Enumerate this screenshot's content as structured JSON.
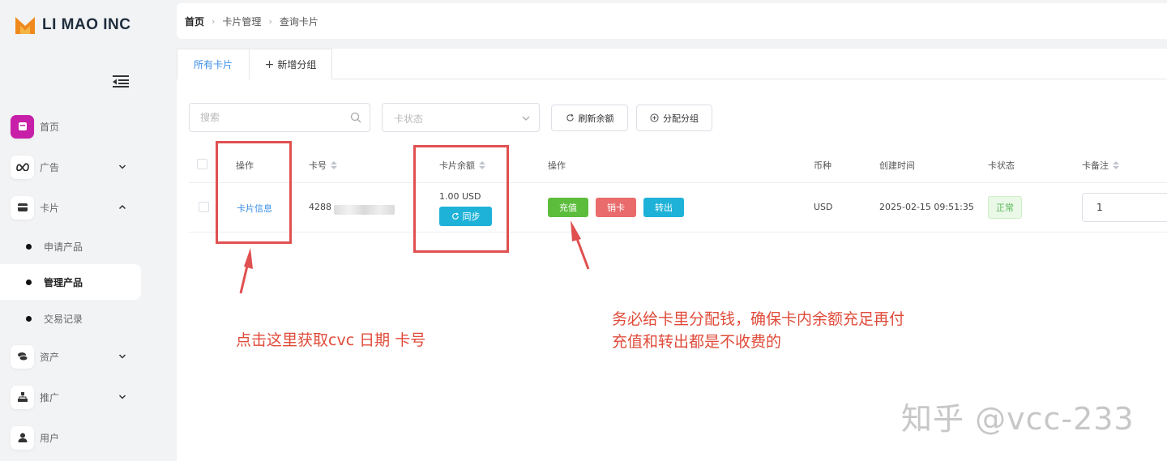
{
  "brand": {
    "name": "LI MAO INC",
    "mark_color": "#f08a1c"
  },
  "sidebar": {
    "items": [
      {
        "label": "首页",
        "icon": "home-icon",
        "active": true
      },
      {
        "label": "广告",
        "icon": "meta-icon",
        "chevron": "down"
      },
      {
        "label": "卡片",
        "icon": "card-icon",
        "chevron": "up"
      },
      {
        "label": "资产",
        "icon": "coins-icon",
        "chevron": "down"
      },
      {
        "label": "推广",
        "icon": "sitemap-icon",
        "chevron": "down"
      },
      {
        "label": "用户",
        "icon": "user-icon"
      }
    ],
    "sub_items": [
      {
        "label": "申请产品"
      },
      {
        "label": "管理产品",
        "active": true
      },
      {
        "label": "交易记录"
      }
    ]
  },
  "breadcrumb": {
    "home": "首页",
    "level2": "卡片管理",
    "level3": "查询卡片"
  },
  "tabs": {
    "all_cards": "所有卡片",
    "add_group": "新增分组"
  },
  "filters": {
    "search_placeholder": "搜索",
    "status_placeholder": "卡状态",
    "refresh_balance": "刷新余额",
    "assign_group": "分配分组"
  },
  "table": {
    "headers": {
      "action": "操作",
      "card_no": "卡号",
      "balance": "卡片余额",
      "operations": "操作",
      "currency": "币种",
      "created": "创建时间",
      "status": "卡状态",
      "remark": "卡备注"
    },
    "row": {
      "card_info": "卡片信息",
      "card_no": "4288",
      "balance": "1.00 USD",
      "sync": "同步",
      "recharge": "充值",
      "cancel": "销卡",
      "transfer_out": "转出",
      "currency": "USD",
      "created": "2025-02-15 09:51:35",
      "status": "正常",
      "remark": "1"
    }
  },
  "colors": {
    "accent": "#3a8ee6",
    "sync": "#1fb2d8",
    "recharge": "#5cbd3c",
    "cancel": "#e96b6b",
    "transfer": "#1fb2d8",
    "annotation": "#e05050"
  },
  "annotations": {
    "left_note": "点击这里获取cvc 日期 卡号",
    "right_note_line1": "务必给卡里分配钱，确保卡内余额充足再付",
    "right_note_line2": "充值和转出都是不收费的"
  },
  "watermark": "知乎 @vcc-233"
}
